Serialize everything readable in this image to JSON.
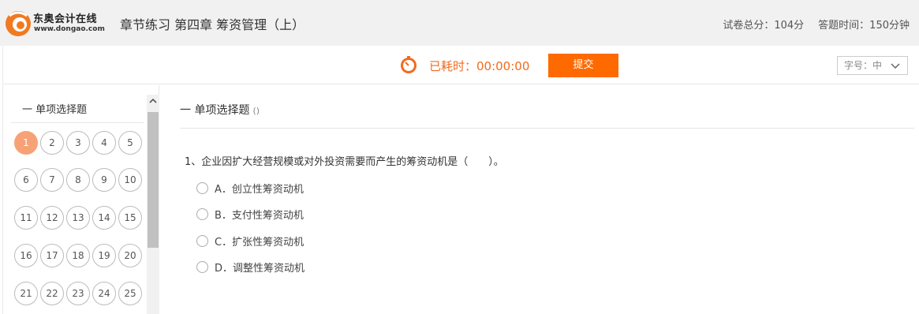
{
  "header": {
    "logo_name": "东奥会计在线",
    "logo_url": "www.dongao.com",
    "title": "章节练习 第四章 筹资管理（上）",
    "total_score": "试卷总分：104分",
    "time_limit": "答题时间：150分钟"
  },
  "toolbar": {
    "elapsed_label": "已耗时：00:00:00",
    "submit_label": "提交",
    "fontsize_label": "字号：中"
  },
  "sidebar": {
    "section_title": "一 单项选择题",
    "numbers": [
      "1",
      "2",
      "3",
      "4",
      "5",
      "6",
      "7",
      "8",
      "9",
      "10",
      "11",
      "12",
      "13",
      "14",
      "15",
      "16",
      "17",
      "18",
      "19",
      "20",
      "21",
      "22",
      "23",
      "24",
      "25"
    ],
    "active": "1"
  },
  "main": {
    "section_title": "一 单项选择题",
    "section_paren": "()",
    "question": "1、企业因扩大经营规模或对外投资需要而产生的筹资动机是（　　）。",
    "options": [
      "A．创立性筹资动机",
      "B．支付性筹资动机",
      "C．扩张性筹资动机",
      "D．调整性筹资动机"
    ]
  },
  "colors": {
    "accent": "#ff6a00",
    "timer": "#f26b1d",
    "active_number": "#f7a276"
  },
  "icons": {
    "logo": "dongao-logo-icon",
    "timer": "stopwatch-icon",
    "dropdown": "chevron-down-icon",
    "scroll_up": "chevron-up-icon"
  }
}
